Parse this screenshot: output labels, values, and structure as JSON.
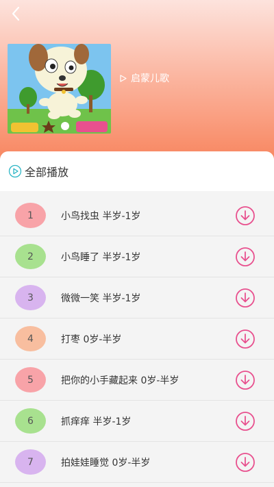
{
  "header": {
    "album_title": "启蒙儿歌"
  },
  "play_all": {
    "label": "全部播放"
  },
  "songs": [
    {
      "num": "1",
      "title": "小鸟找虫 半岁-1岁",
      "color": "#f8a3a8"
    },
    {
      "num": "2",
      "title": "小鸟睡了 半岁-1岁",
      "color": "#a8e18f"
    },
    {
      "num": "3",
      "title": "微微一笑 半岁-1岁",
      "color": "#d8b4ef"
    },
    {
      "num": "4",
      "title": "打枣 0岁-半岁",
      "color": "#f8be9f"
    },
    {
      "num": "5",
      "title": "把你的小手藏起来 0岁-半岁",
      "color": "#f8a3a8"
    },
    {
      "num": "6",
      "title": "抓痒痒 半岁-1岁",
      "color": "#a8e18f"
    },
    {
      "num": "7",
      "title": "拍娃娃睡觉 0岁-半岁",
      "color": "#d8b4ef"
    }
  ],
  "colors": {
    "accent_pink": "#e8508e",
    "play_teal": "#2bb5c5",
    "header_top": "#fde3dd",
    "header_bottom": "#f8845d"
  }
}
